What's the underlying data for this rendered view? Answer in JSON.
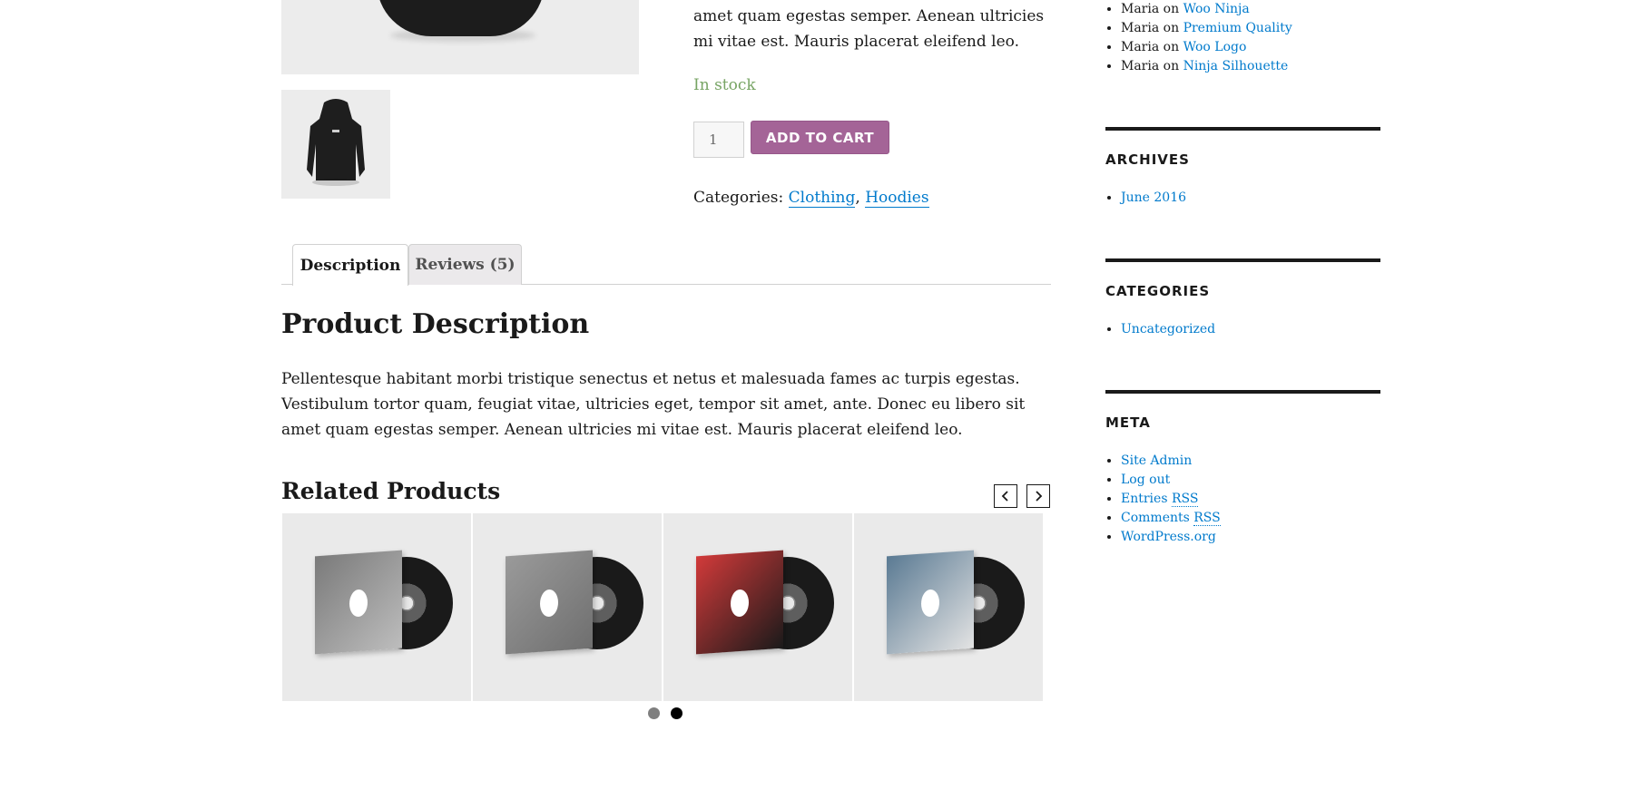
{
  "product": {
    "short_description": "amet quam egestas semper. Aenean ultricies mi vitae est. Mauris placerat eleifend leo.",
    "stock_status": "In stock",
    "quantity": "1",
    "add_to_cart_label": "ADD TO CART",
    "categories_label": "Categories:",
    "categories": [
      "Clothing",
      "Hoodies"
    ],
    "separator": ", "
  },
  "tabs": [
    {
      "label": "Description",
      "active": true
    },
    {
      "label": "Reviews (5)",
      "active": false
    }
  ],
  "description": {
    "heading": "Product Description",
    "text": "Pellentesque habitant morbi tristique senectus et netus et malesuada fames ac turpis egestas. Vestibulum tortor quam, feugiat vitae, ultricies eget, tempor sit amet, ante. Donec eu libero sit amet quam egestas semper. Aenean ultricies mi vitae est. Mauris placerat eleifend leo."
  },
  "related": {
    "heading": "Related Products",
    "products": [
      {
        "sleeve_color": "#7a7a7a",
        "accent": "#bdbdbd"
      },
      {
        "sleeve_color": "#9a9a9a",
        "accent": "#6f6f6f"
      },
      {
        "sleeve_color": "#d23a3a",
        "accent": "#1a1a1a"
      },
      {
        "sleeve_color": "#5a7a93",
        "accent": "#e3e3e3"
      }
    ],
    "slider_dots": [
      {
        "active": false,
        "color": "#7f7f7f"
      },
      {
        "active": true,
        "color": "#000000"
      }
    ]
  },
  "sidebar": {
    "recent_comments": [
      {
        "author": "Maria",
        "on": "on",
        "post": "Woo Ninja"
      },
      {
        "author": "Maria",
        "on": "on",
        "post": "Premium Quality"
      },
      {
        "author": "Maria",
        "on": "on",
        "post": "Woo Logo"
      },
      {
        "author": "Maria",
        "on": "on",
        "post": "Ninja Silhouette"
      }
    ],
    "archives": {
      "title": "ARCHIVES",
      "items": [
        "June 2016"
      ]
    },
    "categories": {
      "title": "CATEGORIES",
      "items": [
        "Uncategorized"
      ]
    },
    "meta": {
      "title": "META",
      "items": [
        {
          "text": "Site Admin"
        },
        {
          "text": "Log out"
        },
        {
          "text": "Entries ",
          "abbr": "RSS"
        },
        {
          "text": "Comments ",
          "abbr": "RSS"
        },
        {
          "text": "WordPress.org"
        }
      ]
    }
  },
  "colors": {
    "link": "#007acc",
    "stock": "#77a464",
    "button": "#a46497"
  }
}
